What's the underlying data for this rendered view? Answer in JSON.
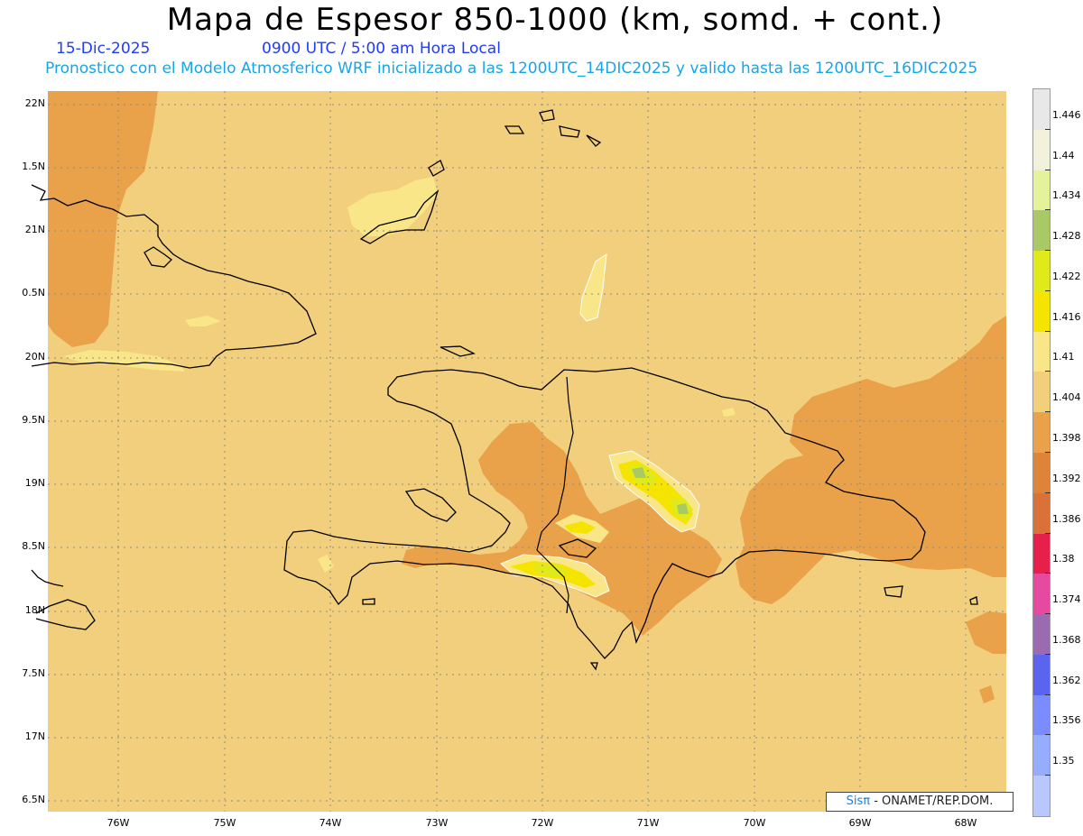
{
  "header": {
    "title": "Mapa de Espesor 850-1000 (km, somd. + cont.)",
    "date": "15-Dic-2025",
    "time": "0900 UTC / 5:00 am Hora Local",
    "forecast": "Pronostico con el Modelo Atmosferico WRF inicializado a las 1200UTC_14DIC2025 y valido hasta las  1200UTC_16DIC2025"
  },
  "chart_data": {
    "type": "heatmap",
    "variable": "Espesor 850-1000",
    "units": "km",
    "lat_labels": [
      "22N",
      "1.5N",
      "21N",
      "0.5N",
      "20N",
      "9.5N",
      "19N",
      "8.5N",
      "18N",
      "7.5N",
      "17N",
      "6.5N"
    ],
    "lon_labels": [
      "76W",
      "75W",
      "74W",
      "73W",
      "72W",
      "71W",
      "70W",
      "69W",
      "68W"
    ],
    "colorbar": {
      "ticks": [
        "1.446",
        "1.44",
        "1.434",
        "1.428",
        "1.422",
        "1.416",
        "1.41",
        "1.404",
        "1.398",
        "1.392",
        "1.386",
        "1.38",
        "1.374",
        "1.368",
        "1.362",
        "1.356",
        "1.35"
      ],
      "colors": [
        "#e8e8e8",
        "#f2f2dc",
        "#e4f29c",
        "#a9c967",
        "#e0ea1a",
        "#f4e400",
        "#f9e688",
        "#f2cf7c",
        "#e9a14a",
        "#de8438",
        "#da7138",
        "#e6204a",
        "#e64aa0",
        "#9a6bb0",
        "#5a64ee",
        "#7a8cff",
        "#96acff",
        "#b8c8ff"
      ]
    },
    "background_value_range": "1.404-1.41",
    "grid": true,
    "features": [
      "coastlines",
      "country-borders"
    ]
  },
  "credit": {
    "brand": "Sisπ",
    "text": " - ONAMET/REP.DOM."
  }
}
